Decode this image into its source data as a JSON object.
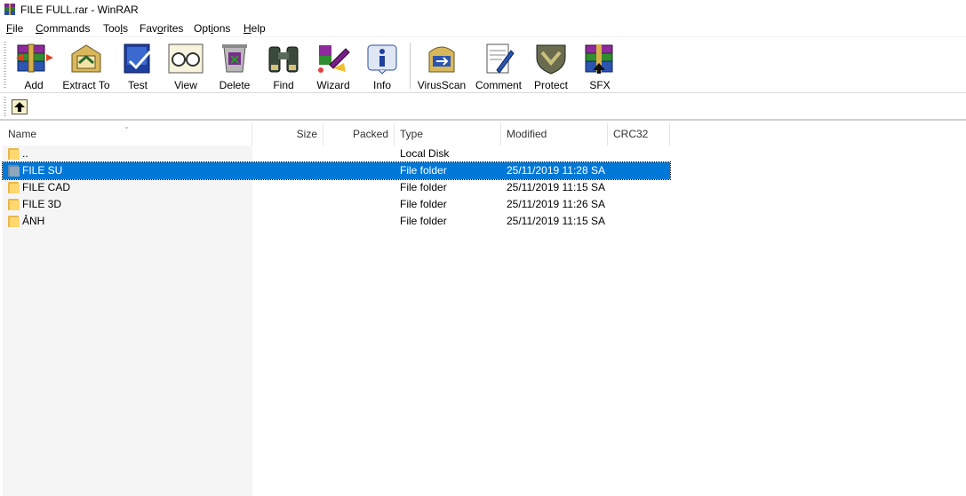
{
  "window": {
    "title": "FILE FULL.rar - WinRAR"
  },
  "menu": [
    {
      "pre": "",
      "acc": "F",
      "post": "ile"
    },
    {
      "pre": "",
      "acc": "C",
      "post": "ommands"
    },
    {
      "pre": "Too",
      "acc": "l",
      "post": "s"
    },
    {
      "pre": "Fav",
      "acc": "o",
      "post": "rites"
    },
    {
      "pre": "Opt",
      "acc": "i",
      "post": "ons"
    },
    {
      "pre": "",
      "acc": "H",
      "post": "elp"
    }
  ],
  "toolbar": {
    "add": "Add",
    "extract_to": "Extract To",
    "test": "Test",
    "view": "View",
    "delete": "Delete",
    "find": "Find",
    "wizard": "Wizard",
    "info": "Info",
    "virusscan": "VirusScan",
    "comment": "Comment",
    "protect": "Protect",
    "sfx": "SFX"
  },
  "columns": {
    "name": "Name",
    "size": "Size",
    "packed": "Packed",
    "type": "Type",
    "modified": "Modified",
    "crc32": "CRC32"
  },
  "files": [
    {
      "name": "..",
      "type": "Local Disk",
      "modified": ""
    },
    {
      "name": "FILE SU",
      "type": "File folder",
      "modified": "25/11/2019 11:28 SA"
    },
    {
      "name": "FILE CAD",
      "type": "File folder",
      "modified": "25/11/2019 11:15 SA"
    },
    {
      "name": "FILE 3D",
      "type": "File folder",
      "modified": "25/11/2019 11:26 SA"
    },
    {
      "name": "ẢNH",
      "type": "File folder",
      "modified": "25/11/2019 11:15 SA"
    }
  ],
  "selected_row": "FILE SU",
  "colors": {
    "selection": "#0078d7",
    "folder": "#ffd76e"
  }
}
